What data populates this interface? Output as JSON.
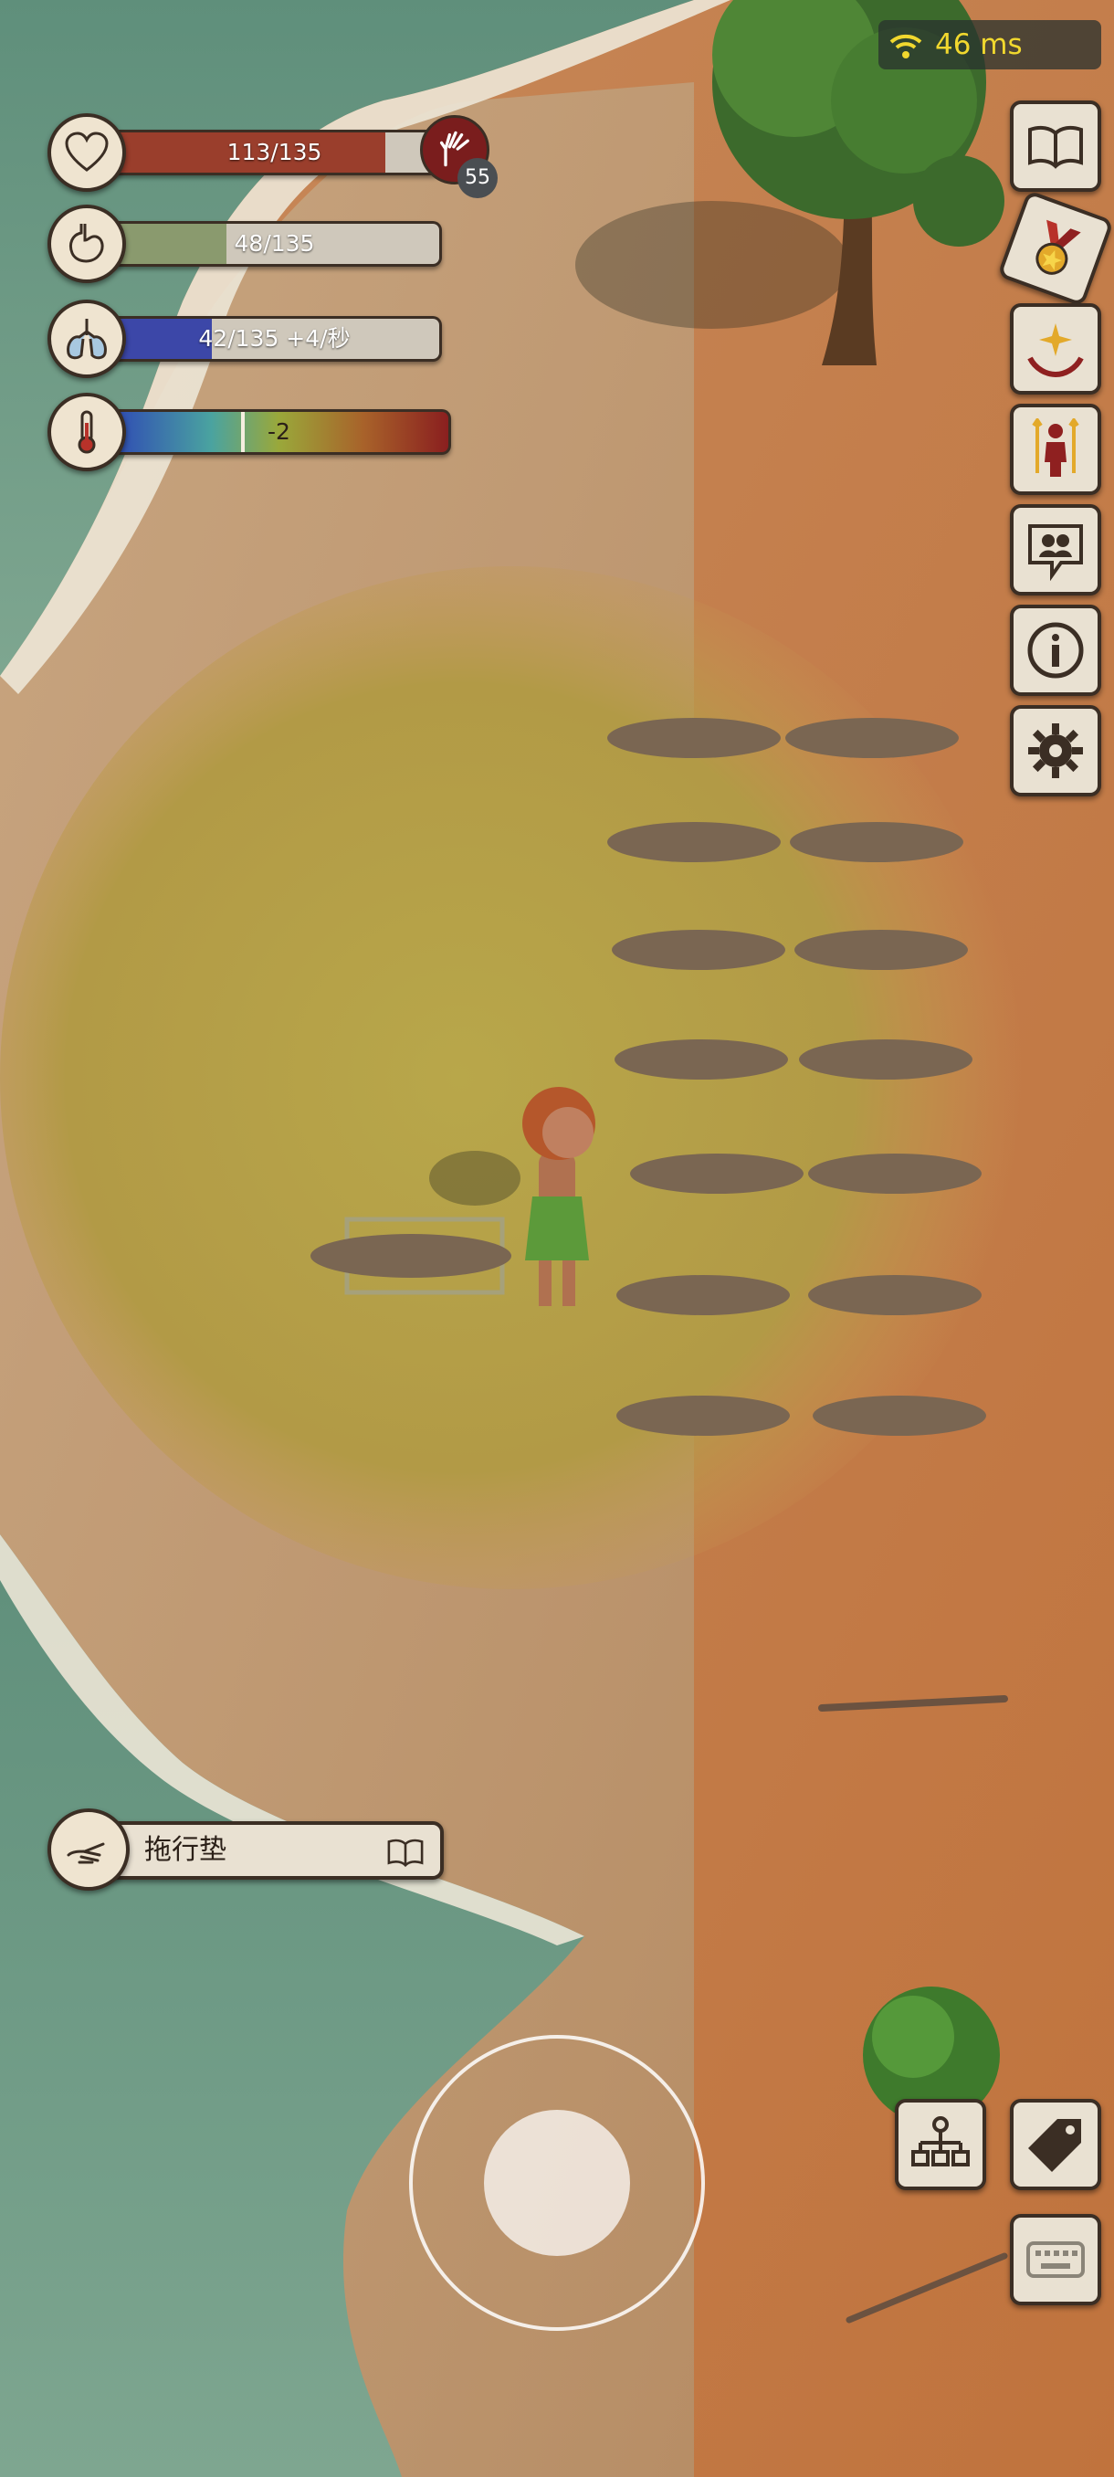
{
  "network": {
    "icon": "wifi-icon",
    "ping": "46 ms"
  },
  "stats": {
    "health": {
      "icon": "heart-icon",
      "label": "113/135",
      "current": 113,
      "max": 135,
      "color": "#9a3e2c"
    },
    "hunger": {
      "icon": "stomach-icon",
      "label": "48/135",
      "current": 48,
      "max": 135,
      "color": "#8a9a6e"
    },
    "oxygen": {
      "icon": "lungs-icon",
      "label": "42/135 +4/秒",
      "current": 42,
      "max": 135,
      "color": "#3c47a8"
    },
    "temperature": {
      "icon": "thermometer-icon",
      "label": "-2"
    }
  },
  "hand_skill": {
    "icon": "open-hand-icon",
    "count": "55"
  },
  "side_menu": [
    {
      "name": "journal",
      "icon": "open-book-icon"
    },
    {
      "name": "achievements",
      "icon": "medal-icon"
    },
    {
      "name": "skills",
      "icon": "sparkle-hands-icon"
    },
    {
      "name": "character",
      "icon": "person-upgrade-icon"
    },
    {
      "name": "social",
      "icon": "chat-people-icon"
    },
    {
      "name": "info",
      "icon": "info-icon"
    },
    {
      "name": "settings",
      "icon": "gear-icon"
    }
  ],
  "crafting": {
    "icon": "open-hand-icon",
    "item_label": "拖行垫",
    "book_icon": "open-book-icon"
  },
  "bottom_buttons": [
    {
      "name": "tech-tree",
      "icon": "hierarchy-icon"
    },
    {
      "name": "tag",
      "icon": "tag-icon"
    },
    {
      "name": "keyboard",
      "icon": "keyboard-icon"
    }
  ],
  "colors": {
    "panel": "#e9e1d2",
    "outline": "#3b2e24",
    "ping_text": "#f1d82e",
    "hand_badge": "#7a1d1d"
  }
}
